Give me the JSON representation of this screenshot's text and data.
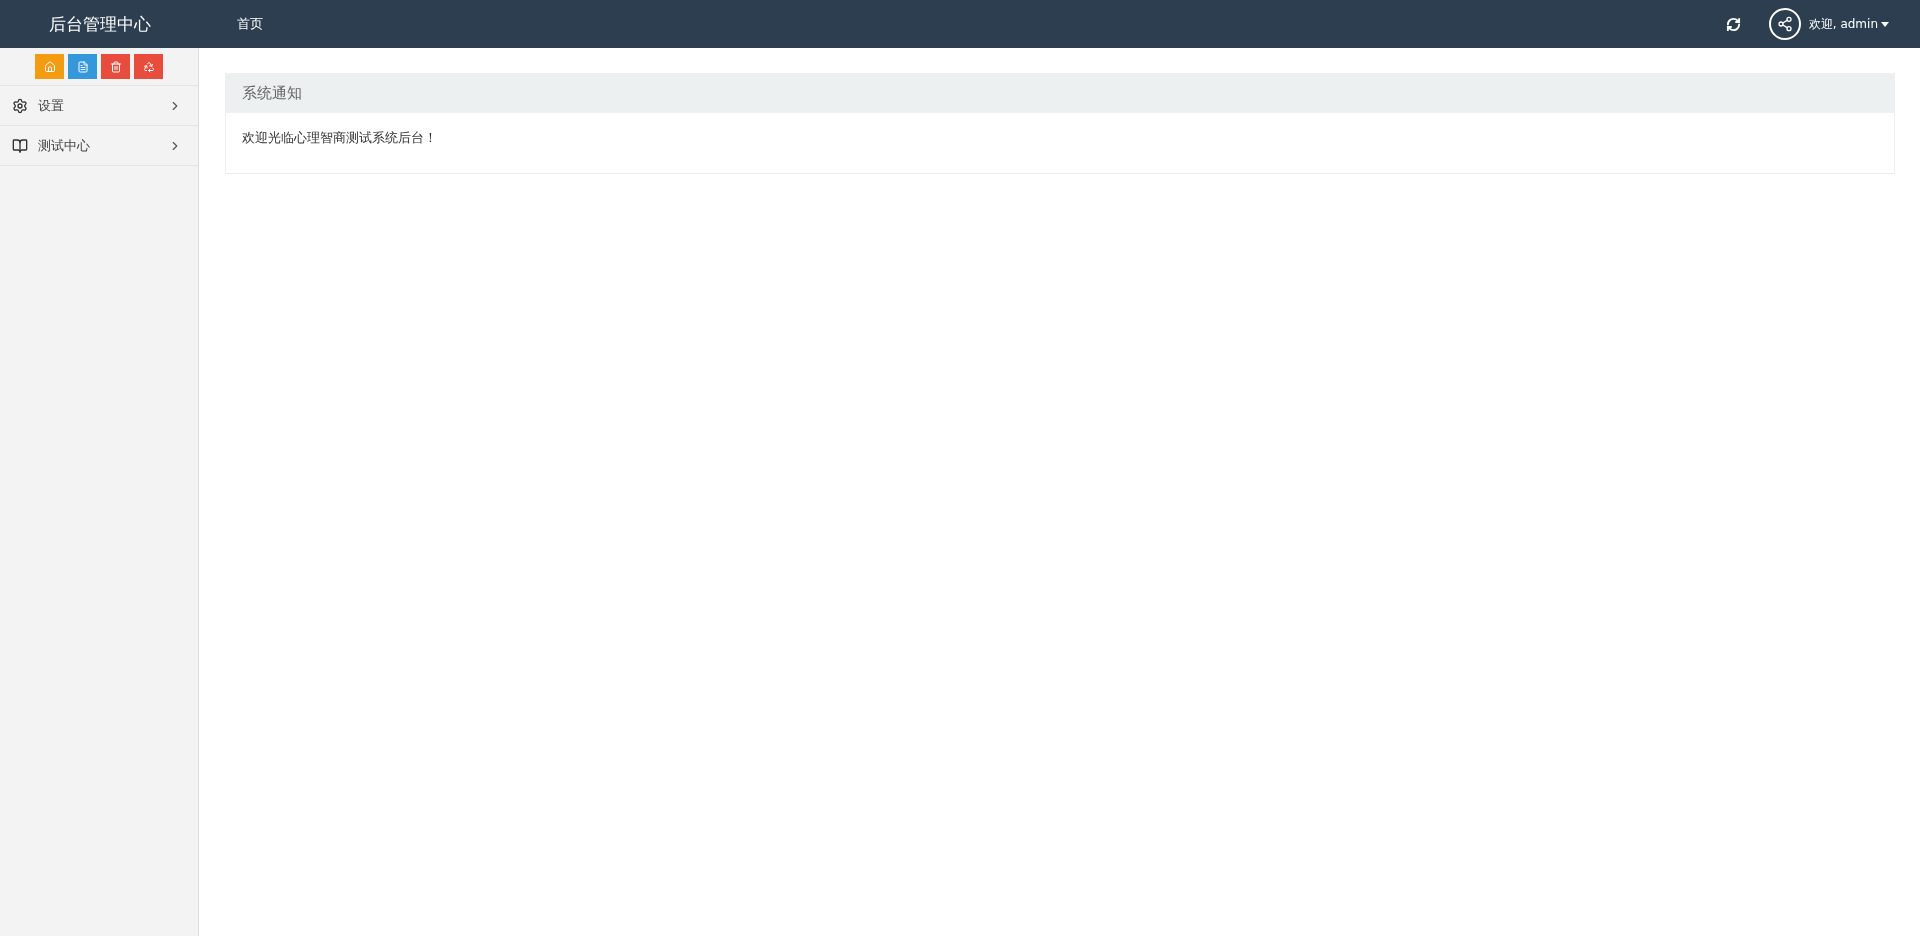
{
  "header": {
    "title": "后台管理中心",
    "nav": [
      {
        "label": "首页"
      }
    ],
    "user": {
      "greeting": "欢迎, admin"
    }
  },
  "sidebar": {
    "shortcuts": [
      {
        "kind": "home",
        "color": "#f39c12"
      },
      {
        "kind": "file",
        "color": "#3498db"
      },
      {
        "kind": "trash",
        "color": "#e74c3c"
      },
      {
        "kind": "recycle",
        "color": "#e74c3c"
      }
    ],
    "items": [
      {
        "kind": "settings",
        "label": "设置",
        "expanded": false
      },
      {
        "kind": "book",
        "label": "测试中心",
        "expanded": false
      }
    ]
  },
  "panel": {
    "heading": "系统通知",
    "body": "欢迎光临心理智商测试系统后台！"
  }
}
